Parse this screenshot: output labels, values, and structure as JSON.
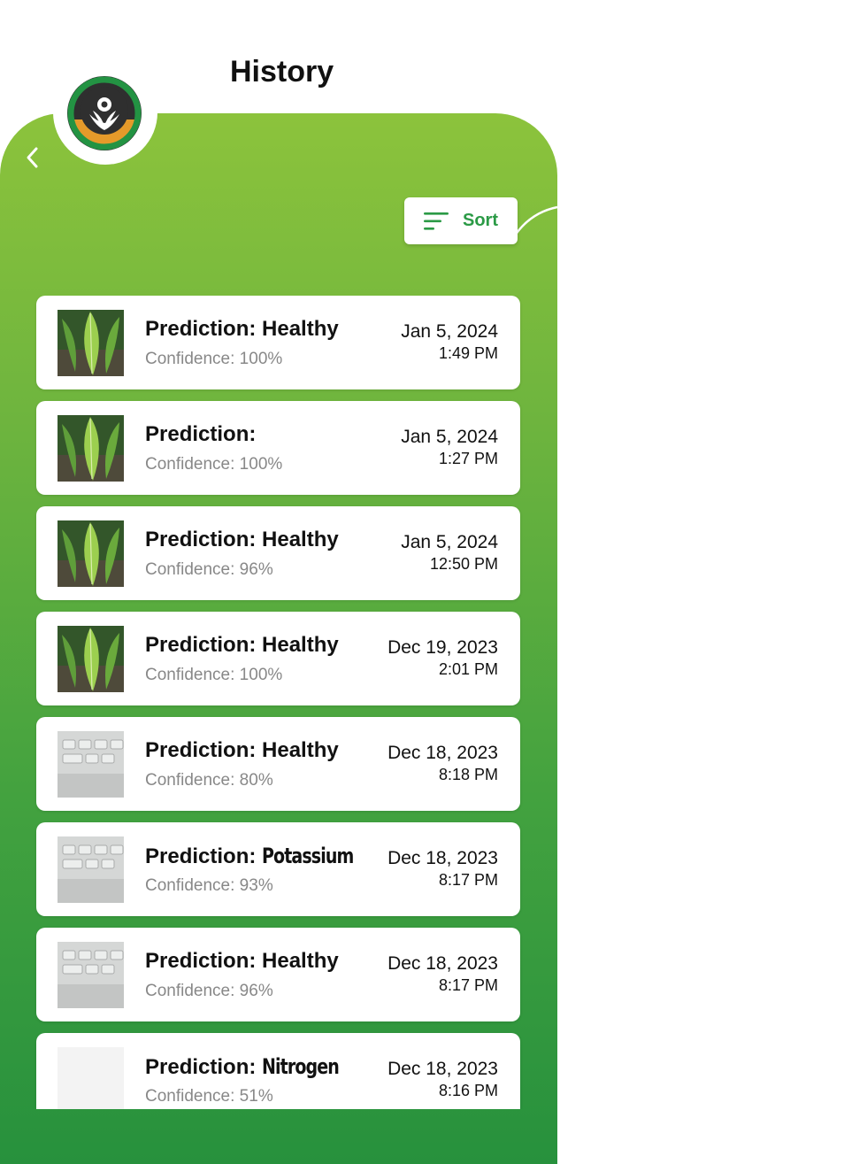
{
  "header": {
    "title": "History"
  },
  "sort": {
    "label": "Sort"
  },
  "colors": {
    "accent": "#2b9a46",
    "panel_top": "#8cc33c",
    "panel_bottom": "#27913d"
  },
  "history": [
    {
      "prediction_label": "Prediction:",
      "prediction_value": "Healthy",
      "confidence": "Confidence: 100%",
      "date": "Jan 5, 2024",
      "time": "1:49 PM",
      "thumb": "leaf"
    },
    {
      "prediction_label": "Prediction:",
      "prediction_value": "",
      "confidence": "Confidence: 100%",
      "date": "Jan 5, 2024",
      "time": "1:27 PM",
      "thumb": "leaf"
    },
    {
      "prediction_label": "Prediction:",
      "prediction_value": "Healthy",
      "confidence": "Confidence: 96%",
      "date": "Jan 5, 2024",
      "time": "12:50 PM",
      "thumb": "leaf"
    },
    {
      "prediction_label": "Prediction:",
      "prediction_value": "Healthy",
      "confidence": "Confidence: 100%",
      "date": "Dec 19, 2023",
      "time": "2:01 PM",
      "thumb": "leaf"
    },
    {
      "prediction_label": "Prediction:",
      "prediction_value": "Healthy",
      "confidence": "Confidence: 80%",
      "date": "Dec 18, 2023",
      "time": "8:18 PM",
      "thumb": "keyboard"
    },
    {
      "prediction_label": "Prediction:",
      "prediction_value": "Potassium",
      "confidence": "Confidence: 93%",
      "date": "Dec 18, 2023",
      "time": "8:17 PM",
      "thumb": "keyboard"
    },
    {
      "prediction_label": "Prediction:",
      "prediction_value": "Healthy",
      "confidence": "Confidence: 96%",
      "date": "Dec 18, 2023",
      "time": "8:17 PM",
      "thumb": "keyboard"
    },
    {
      "prediction_label": "Prediction:",
      "prediction_value": "Nitrogen",
      "confidence": "Confidence: 51%",
      "date": "Dec 18, 2023",
      "time": "8:16 PM",
      "thumb": "blank"
    }
  ]
}
